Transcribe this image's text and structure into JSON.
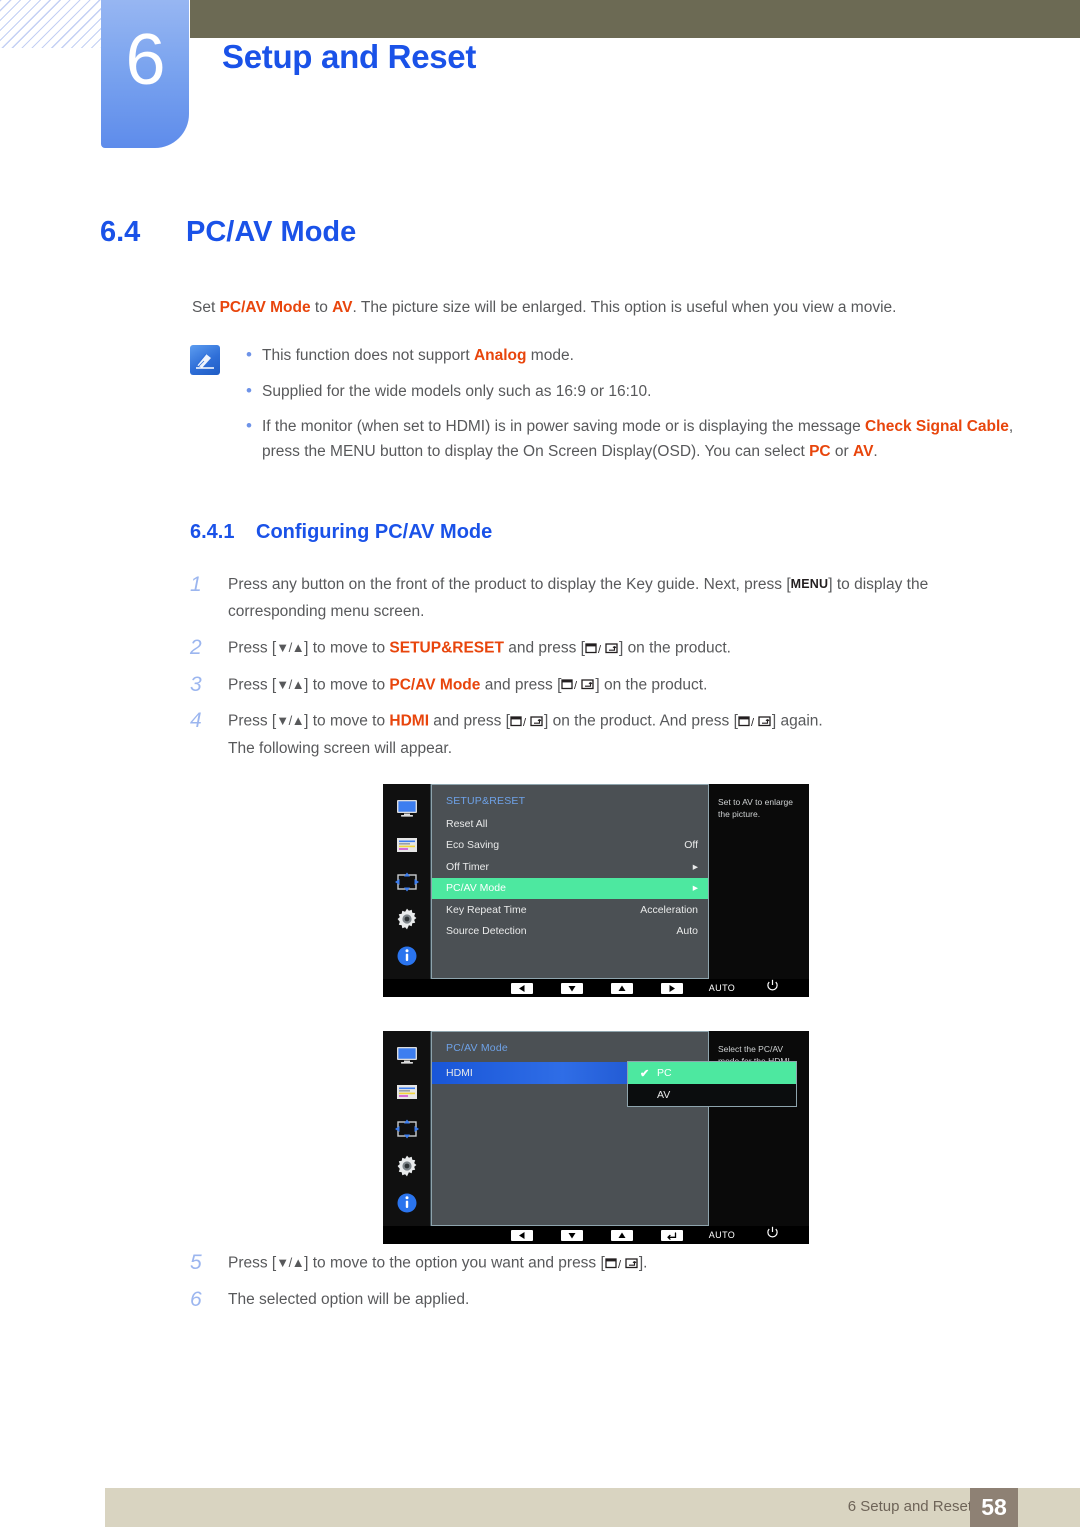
{
  "chapter": {
    "number": "6",
    "title": "Setup and Reset"
  },
  "section": {
    "number": "6.4",
    "title": "PC/AV Mode",
    "intro_prefix": "Set ",
    "intro_term1": "PC/AV Mode",
    "intro_mid": " to ",
    "intro_term2": "AV",
    "intro_suffix": ". The picture size will be enlarged. This option is useful when you view a movie."
  },
  "note": {
    "icon": "note-pencil-icon",
    "bullet_glyph": "•",
    "items": [
      {
        "a": "This function does not support ",
        "hl1": "Analog",
        "b": " mode."
      },
      {
        "a": "Supplied for the wide models only such as 16:9 or 16:10.",
        "hl1": "",
        "b": ""
      },
      {
        "a": "If the monitor (when set to HDMI) is in power saving mode or is displaying the message ",
        "hl1": "Check Signal Cable",
        "b": ", press the MENU button to display the On Screen Display(OSD). You can select ",
        "hl2": "PC",
        "c": " or ",
        "hl3": "AV",
        "d": "."
      }
    ]
  },
  "subsection": {
    "number": "6.4.1",
    "title": "Configuring PC/AV Mode"
  },
  "steps": [
    {
      "num": "1",
      "p1": "Press any button on the front of the product to display the Key guide. Next, press [",
      "key": "MENU",
      "p2": "] to display the corresponding menu screen."
    },
    {
      "num": "2",
      "p1": "Press [",
      "arrows": "▼/▲",
      "p2": "] to move to ",
      "hl": "SETUP&RESET",
      "p3": " and press [",
      "p4": "] on the product."
    },
    {
      "num": "3",
      "p1": "Press [",
      "arrows": "▼/▲",
      "p2": "] to move to ",
      "hl": "PC/AV Mode",
      "p3": " and press [",
      "p4": "] on the product."
    },
    {
      "num": "4",
      "p1": "Press [",
      "arrows": "▼/▲",
      "p2": "] to move to ",
      "hl": "HDMI",
      "p3": " and press [",
      "p4": "] on the product. And press [",
      "p5": "] again.",
      "p6": "The following screen will appear."
    }
  ],
  "steps_tail": [
    {
      "num": "5",
      "p1": "Press [",
      "arrows": "▼/▲",
      "p2": "] to move to the option you want and press [",
      "p3": "]."
    },
    {
      "num": "6",
      "p1": "The selected option will be applied."
    }
  ],
  "osd1": {
    "title": "SETUP&RESET",
    "sidebar_icons": [
      "monitor-icon",
      "picture-icon",
      "size-position-icon",
      "gear-icon",
      "info-icon"
    ],
    "items": [
      {
        "label": "Reset All",
        "value": "",
        "selected": false,
        "arrow": false
      },
      {
        "label": "Eco Saving",
        "value": "Off",
        "selected": false,
        "arrow": false
      },
      {
        "label": "Off Timer",
        "value": "",
        "selected": false,
        "arrow": true
      },
      {
        "label": "PC/AV Mode",
        "value": "",
        "selected": true,
        "arrow": true
      },
      {
        "label": "Key Repeat Time",
        "value": "Acceleration",
        "selected": false,
        "arrow": false
      },
      {
        "label": "Source Detection",
        "value": "Auto",
        "selected": false,
        "arrow": false
      }
    ],
    "tooltip": "Set to AV to enlarge the picture.",
    "buttons": [
      "left-arrow-icon",
      "down-arrow-icon",
      "up-arrow-icon",
      "right-arrow-icon"
    ],
    "auto_label": "AUTO",
    "power_icon": "power-icon",
    "highlight_color": "#4de8a0"
  },
  "osd2": {
    "title": "PC/AV Mode",
    "sidebar_icons": [
      "monitor-icon",
      "picture-icon",
      "size-position-icon",
      "gear-icon",
      "info-icon"
    ],
    "source_row": "HDMI",
    "options": [
      {
        "label": "PC",
        "checked": true,
        "selected": true
      },
      {
        "label": "AV",
        "checked": false,
        "selected": false
      }
    ],
    "check_glyph": "✔",
    "tooltip": "Select the PC/AV mode for the HDMI source.",
    "buttons": [
      "left-arrow-icon",
      "down-arrow-icon",
      "up-arrow-icon",
      "enter-icon"
    ],
    "auto_label": "AUTO",
    "power_icon": "power-icon",
    "highlight_color": "#4de8a0",
    "source_color": "#1f5ad5"
  },
  "footer": {
    "text": "6 Setup and Reset",
    "page": "58"
  },
  "colors": {
    "accent_blue": "#1a52e8",
    "highlight_orange": "#e8450c",
    "olive": "#6c6a54",
    "footer_beige": "#d9d4c1",
    "page_box": "#8e8174"
  }
}
